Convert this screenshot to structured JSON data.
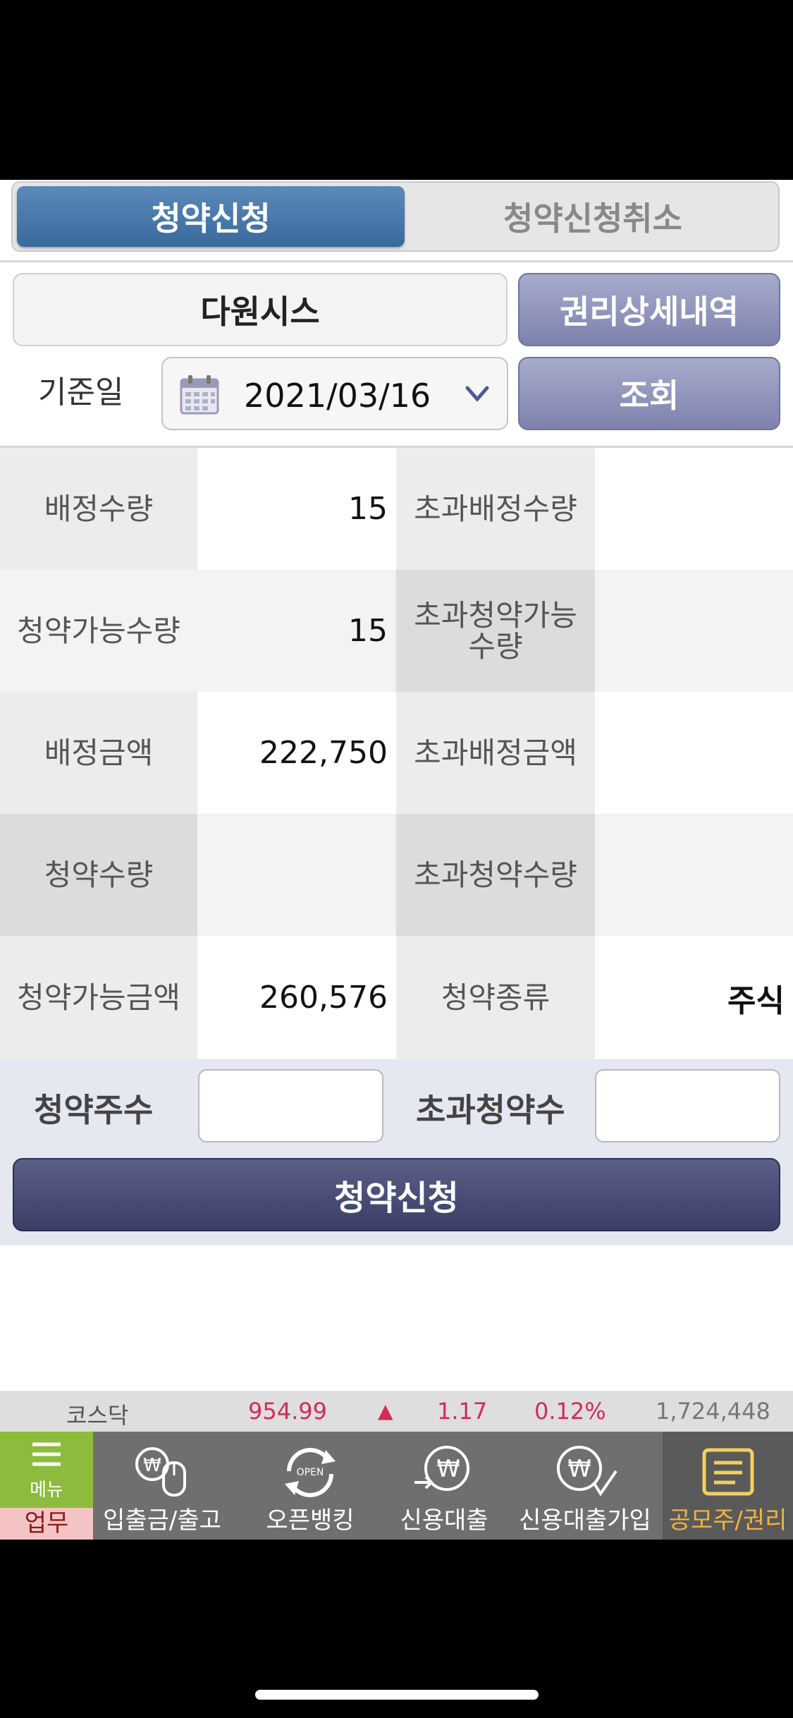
{
  "tabs": {
    "apply": "청약신청",
    "cancel": "청약신청취소"
  },
  "stock_name": "다원시스",
  "rights_button": "권리상세내역",
  "date": {
    "label": "기준일",
    "value": "2021/03/16"
  },
  "query_button": "조회",
  "table": {
    "rows": [
      {
        "l1": "배정수량",
        "v1": "15",
        "l2": "초과배정수량",
        "v2": ""
      },
      {
        "l1": "청약가능수량",
        "v1": "15",
        "l2": "초과청약가능\n수량",
        "v2": ""
      },
      {
        "l1": "배정금액",
        "v1": "222,750",
        "l2": "초과배정금액",
        "v2": ""
      },
      {
        "l1": "청약수량",
        "v1": "",
        "l2": "초과청약수량",
        "v2": ""
      },
      {
        "l1": "청약가능금액",
        "v1": "260,576",
        "l2": "청약종류",
        "v2": "주식"
      }
    ]
  },
  "inputs": {
    "shares_label": "청약주수",
    "shares_value": "",
    "excess_label": "초과청약수",
    "excess_value": ""
  },
  "submit_button": "청약신청",
  "ticker": {
    "name": "코스닥",
    "index": "954.99",
    "arrow": "▲",
    "change": "1.17",
    "percent": "0.12%",
    "volume": "1,724,448"
  },
  "bottom_nav": {
    "menu_icon_label": "메뉴",
    "menu_label": "업무",
    "items": [
      "입출금/출고",
      "오픈뱅킹",
      "신용대출",
      "신용대출가입",
      "공모주/권리"
    ]
  },
  "colors": {
    "active_tab": "#4a7aab",
    "purple_button": "#8a8fb8",
    "submit": "#474a73",
    "ticker_red": "#d42a5a",
    "active_nav": "#f2b33d"
  }
}
